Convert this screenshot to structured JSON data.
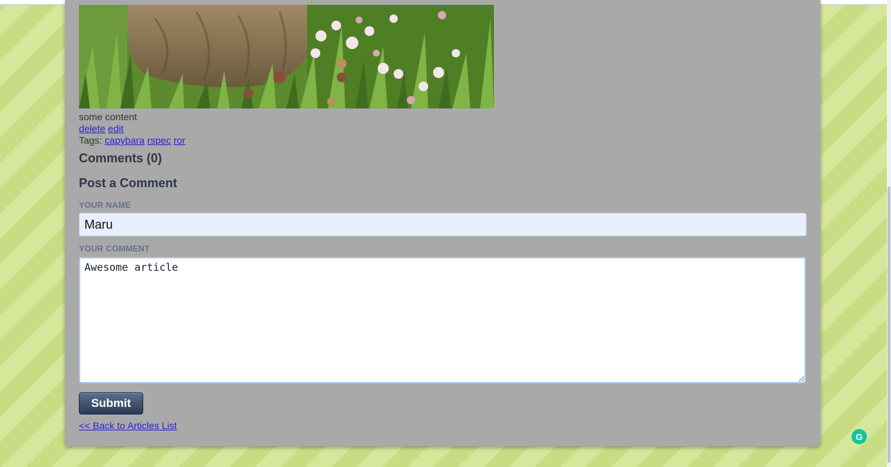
{
  "article": {
    "image_subject": "capybara in grass with clover flowers",
    "body": "some content",
    "actions": {
      "delete_label": "delete",
      "edit_label": "edit"
    },
    "tags_label": "Tags:",
    "tags": [
      "capybara",
      "rspec",
      "ror"
    ]
  },
  "comments": {
    "heading": "Comments (0)"
  },
  "comment_form": {
    "heading": "Post a Comment",
    "name_label": "YOUR NAME",
    "name_value": "Maru",
    "comment_label": "YOUR COMMENT",
    "comment_value": "Awesome article",
    "submit_label": "Submit"
  },
  "navigation": {
    "back_link_label": "<< Back to Articles List"
  },
  "extension": {
    "grammarly_icon": "grammarly-icon",
    "grammarly_glyph": "G"
  },
  "colors": {
    "background_stripe_light": "#d6e79c",
    "background_stripe_dark": "#c8dc83",
    "card": "#a9a9a9",
    "link": "#2a1fd6",
    "heading": "#2d3748",
    "input_autofill": "#e8f0fe",
    "button": "#2c3b55",
    "grammarly": "#15c39a"
  }
}
